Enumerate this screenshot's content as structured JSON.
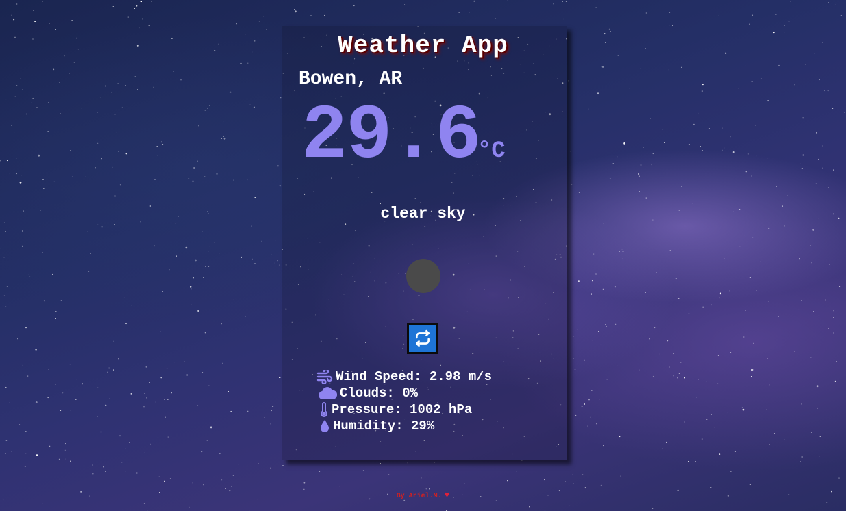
{
  "app": {
    "title": "Weather App"
  },
  "location": {
    "city": "Bowen, AR"
  },
  "current": {
    "temperature": "29.6",
    "unit": "°C",
    "description": "clear sky",
    "icon": "weather-condition-icon"
  },
  "controls": {
    "refresh_icon": "refresh-icon"
  },
  "details": [
    {
      "icon": "wind-icon",
      "label": "Wind Speed: 2.98 m/s"
    },
    {
      "icon": "cloud-icon",
      "label": "Clouds: 0%"
    },
    {
      "icon": "thermometer-icon",
      "label": "Pressure: 1002 hPa"
    },
    {
      "icon": "droplet-icon",
      "label": "Humidity: 29%"
    }
  ],
  "footer": {
    "credit": "By Ariel.M."
  },
  "colors": {
    "accent": "#8f84f0",
    "refresh_button": "#1e74d6",
    "footer_text": "#d32020"
  }
}
